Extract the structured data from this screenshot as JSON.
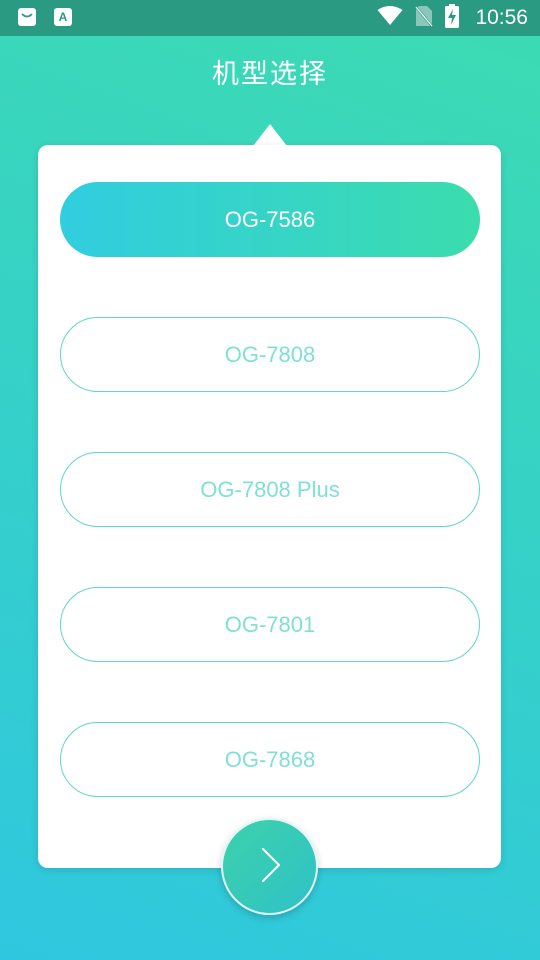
{
  "status_bar": {
    "time": "10:56",
    "left_icons": [
      "app-notification-icon",
      "app-a-icon"
    ],
    "left_icon_glyph": "A",
    "right_icons": [
      "wifi-icon",
      "no-sim-icon",
      "battery-charging-icon"
    ]
  },
  "header": {
    "title": "机型选择"
  },
  "models": [
    {
      "label": "OG-7586",
      "selected": true
    },
    {
      "label": "OG-7808",
      "selected": false
    },
    {
      "label": "OG-7808 Plus",
      "selected": false
    },
    {
      "label": "OG-7801",
      "selected": false
    },
    {
      "label": "OG-7868",
      "selected": false
    }
  ],
  "next_button": {
    "icon": "chevron-right-icon"
  },
  "colors": {
    "accent_start": "#31cde0",
    "accent_end": "#3bdcad",
    "status_bar": "#2a9a82",
    "unselected_text": "#7fe0d6",
    "unselected_border": "#5fd6c8"
  }
}
